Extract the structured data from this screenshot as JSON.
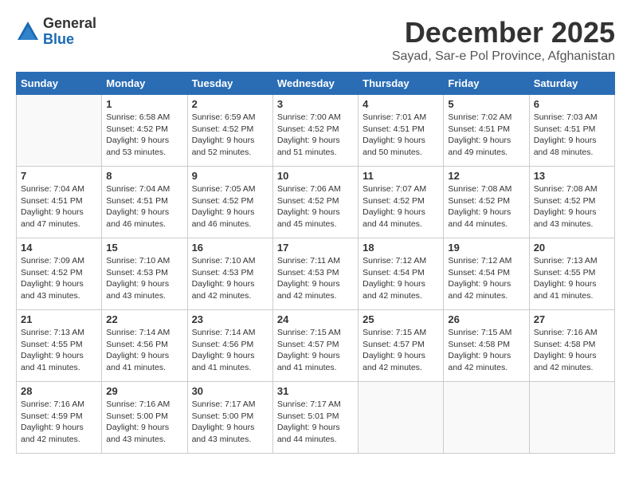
{
  "logo": {
    "general": "General",
    "blue": "Blue"
  },
  "header": {
    "title": "December 2025",
    "subtitle": "Sayad, Sar-e Pol Province, Afghanistan"
  },
  "weekdays": [
    "Sunday",
    "Monday",
    "Tuesday",
    "Wednesday",
    "Thursday",
    "Friday",
    "Saturday"
  ],
  "weeks": [
    [
      {
        "day": null
      },
      {
        "day": 1,
        "sunrise": "6:58 AM",
        "sunset": "4:52 PM",
        "daylight": "9 hours and 53 minutes."
      },
      {
        "day": 2,
        "sunrise": "6:59 AM",
        "sunset": "4:52 PM",
        "daylight": "9 hours and 52 minutes."
      },
      {
        "day": 3,
        "sunrise": "7:00 AM",
        "sunset": "4:52 PM",
        "daylight": "9 hours and 51 minutes."
      },
      {
        "day": 4,
        "sunrise": "7:01 AM",
        "sunset": "4:51 PM",
        "daylight": "9 hours and 50 minutes."
      },
      {
        "day": 5,
        "sunrise": "7:02 AM",
        "sunset": "4:51 PM",
        "daylight": "9 hours and 49 minutes."
      },
      {
        "day": 6,
        "sunrise": "7:03 AM",
        "sunset": "4:51 PM",
        "daylight": "9 hours and 48 minutes."
      }
    ],
    [
      {
        "day": 7,
        "sunrise": "7:04 AM",
        "sunset": "4:51 PM",
        "daylight": "9 hours and 47 minutes."
      },
      {
        "day": 8,
        "sunrise": "7:04 AM",
        "sunset": "4:51 PM",
        "daylight": "9 hours and 46 minutes."
      },
      {
        "day": 9,
        "sunrise": "7:05 AM",
        "sunset": "4:52 PM",
        "daylight": "9 hours and 46 minutes."
      },
      {
        "day": 10,
        "sunrise": "7:06 AM",
        "sunset": "4:52 PM",
        "daylight": "9 hours and 45 minutes."
      },
      {
        "day": 11,
        "sunrise": "7:07 AM",
        "sunset": "4:52 PM",
        "daylight": "9 hours and 44 minutes."
      },
      {
        "day": 12,
        "sunrise": "7:08 AM",
        "sunset": "4:52 PM",
        "daylight": "9 hours and 44 minutes."
      },
      {
        "day": 13,
        "sunrise": "7:08 AM",
        "sunset": "4:52 PM",
        "daylight": "9 hours and 43 minutes."
      }
    ],
    [
      {
        "day": 14,
        "sunrise": "7:09 AM",
        "sunset": "4:52 PM",
        "daylight": "9 hours and 43 minutes."
      },
      {
        "day": 15,
        "sunrise": "7:10 AM",
        "sunset": "4:53 PM",
        "daylight": "9 hours and 43 minutes."
      },
      {
        "day": 16,
        "sunrise": "7:10 AM",
        "sunset": "4:53 PM",
        "daylight": "9 hours and 42 minutes."
      },
      {
        "day": 17,
        "sunrise": "7:11 AM",
        "sunset": "4:53 PM",
        "daylight": "9 hours and 42 minutes."
      },
      {
        "day": 18,
        "sunrise": "7:12 AM",
        "sunset": "4:54 PM",
        "daylight": "9 hours and 42 minutes."
      },
      {
        "day": 19,
        "sunrise": "7:12 AM",
        "sunset": "4:54 PM",
        "daylight": "9 hours and 42 minutes."
      },
      {
        "day": 20,
        "sunrise": "7:13 AM",
        "sunset": "4:55 PM",
        "daylight": "9 hours and 41 minutes."
      }
    ],
    [
      {
        "day": 21,
        "sunrise": "7:13 AM",
        "sunset": "4:55 PM",
        "daylight": "9 hours and 41 minutes."
      },
      {
        "day": 22,
        "sunrise": "7:14 AM",
        "sunset": "4:56 PM",
        "daylight": "9 hours and 41 minutes."
      },
      {
        "day": 23,
        "sunrise": "7:14 AM",
        "sunset": "4:56 PM",
        "daylight": "9 hours and 41 minutes."
      },
      {
        "day": 24,
        "sunrise": "7:15 AM",
        "sunset": "4:57 PM",
        "daylight": "9 hours and 41 minutes."
      },
      {
        "day": 25,
        "sunrise": "7:15 AM",
        "sunset": "4:57 PM",
        "daylight": "9 hours and 42 minutes."
      },
      {
        "day": 26,
        "sunrise": "7:15 AM",
        "sunset": "4:58 PM",
        "daylight": "9 hours and 42 minutes."
      },
      {
        "day": 27,
        "sunrise": "7:16 AM",
        "sunset": "4:58 PM",
        "daylight": "9 hours and 42 minutes."
      }
    ],
    [
      {
        "day": 28,
        "sunrise": "7:16 AM",
        "sunset": "4:59 PM",
        "daylight": "9 hours and 42 minutes."
      },
      {
        "day": 29,
        "sunrise": "7:16 AM",
        "sunset": "5:00 PM",
        "daylight": "9 hours and 43 minutes."
      },
      {
        "day": 30,
        "sunrise": "7:17 AM",
        "sunset": "5:00 PM",
        "daylight": "9 hours and 43 minutes."
      },
      {
        "day": 31,
        "sunrise": "7:17 AM",
        "sunset": "5:01 PM",
        "daylight": "9 hours and 44 minutes."
      },
      {
        "day": null
      },
      {
        "day": null
      },
      {
        "day": null
      }
    ]
  ]
}
